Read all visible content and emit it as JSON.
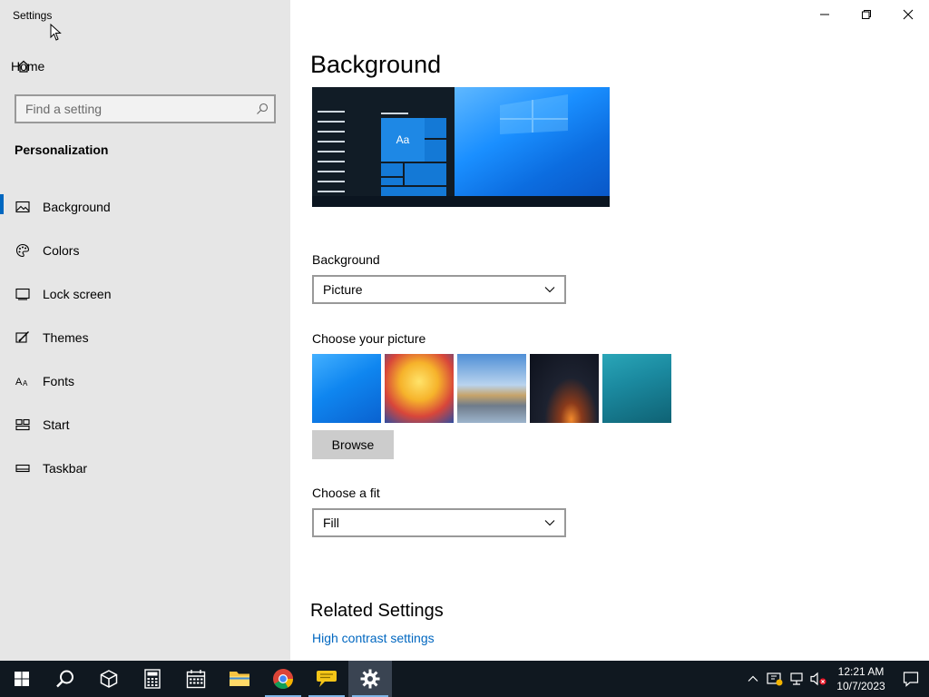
{
  "window": {
    "title": "Settings"
  },
  "sidebar": {
    "home_label": "Home",
    "search_placeholder": "Find a setting",
    "section_title": "Personalization",
    "items": [
      {
        "label": "Background",
        "icon": "picture-icon",
        "active": true
      },
      {
        "label": "Colors",
        "icon": "palette-icon",
        "active": false
      },
      {
        "label": "Lock screen",
        "icon": "lock-screen-icon",
        "active": false
      },
      {
        "label": "Themes",
        "icon": "themes-icon",
        "active": false
      },
      {
        "label": "Fonts",
        "icon": "fonts-icon",
        "active": false
      },
      {
        "label": "Start",
        "icon": "start-icon",
        "active": false
      },
      {
        "label": "Taskbar",
        "icon": "taskbar-icon",
        "active": false
      }
    ]
  },
  "main": {
    "title": "Background",
    "preview_sample_text": "Aa",
    "background_label": "Background",
    "background_value": "Picture",
    "choose_picture_label": "Choose your picture",
    "browse_label": "Browse",
    "fit_label": "Choose a fit",
    "fit_value": "Fill",
    "related_title": "Related Settings",
    "related_link": "High contrast settings"
  },
  "taskbar": {
    "time": "12:21 AM",
    "date": "10/7/2023",
    "colors": {
      "accent": "#0067c0",
      "taskbar_bg": "#101820"
    }
  }
}
